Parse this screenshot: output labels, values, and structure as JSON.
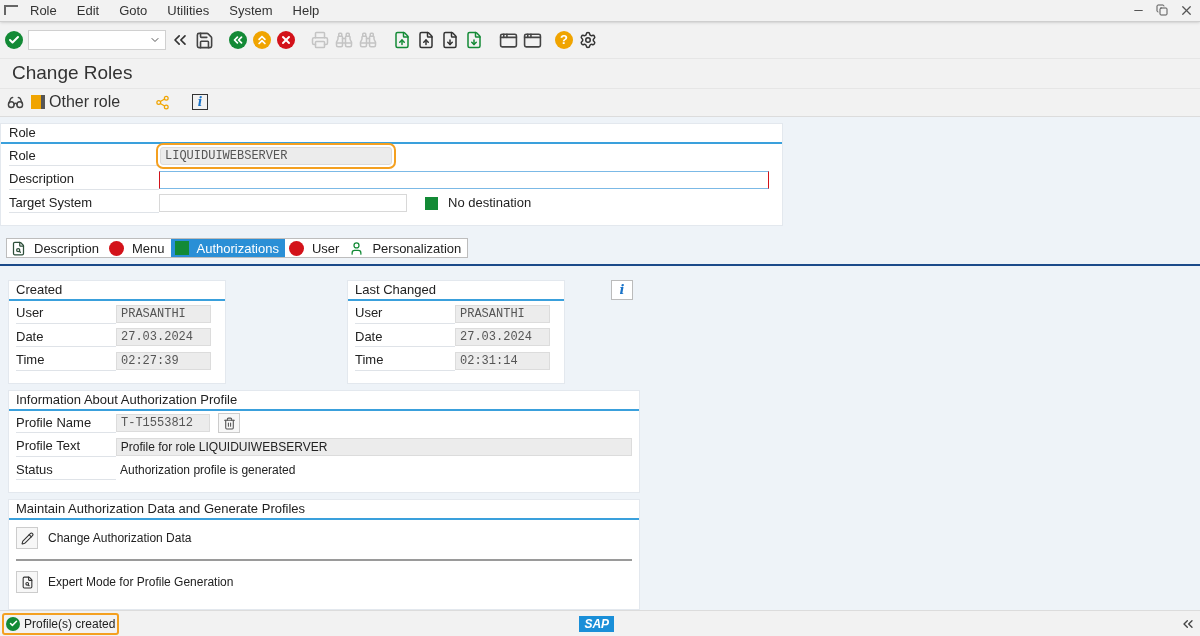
{
  "menu_bar": [
    "Role",
    "Edit",
    "Goto",
    "Utilities",
    "System",
    "Help"
  ],
  "toolbar": {
    "help": "?"
  },
  "title": "Change Roles",
  "app_toolbar": {
    "other_role": "Other role",
    "info": "i"
  },
  "role_panel": {
    "heading": "Role",
    "rows": [
      {
        "label": "Role",
        "value": "LIQUIDUIWEBSERVER",
        "kind": "readonly",
        "highlighted": true
      },
      {
        "label": "Description",
        "value": "",
        "kind": "focused",
        "highlighted": false
      },
      {
        "label": "Target System",
        "value": "",
        "kind": "input",
        "highlighted": false,
        "status": "No destination"
      }
    ]
  },
  "tabs": [
    {
      "label": "Description",
      "kind": "document",
      "selected": false
    },
    {
      "label": "Menu",
      "kind": "red-dot",
      "selected": false
    },
    {
      "label": "Authorizations",
      "kind": "green-square",
      "selected": true
    },
    {
      "label": "User",
      "kind": "red-dot",
      "selected": false
    },
    {
      "label": "Personalization",
      "kind": "person",
      "selected": false
    }
  ],
  "info_button": "i",
  "created": {
    "heading": "Created",
    "rows": [
      {
        "label": "User",
        "value": "PRASANTHI"
      },
      {
        "label": "Date",
        "value": "27.03.2024"
      },
      {
        "label": "Time",
        "value": "02:27:39"
      }
    ]
  },
  "last_changed": {
    "heading": "Last Changed",
    "rows": [
      {
        "label": "User",
        "value": "PRASANTHI"
      },
      {
        "label": "Date",
        "value": "27.03.2024"
      },
      {
        "label": "Time",
        "value": "02:31:14"
      }
    ]
  },
  "profile_info": {
    "heading": "Information About Authorization Profile",
    "profile_name_label": "Profile Name",
    "profile_name": "T-T1553812",
    "profile_text_label": "Profile Text",
    "profile_text": "Profile for role LIQUIDUIWEBSERVER",
    "status_label": "Status",
    "status": "Authorization profile is generated"
  },
  "maintain": {
    "heading": "Maintain Authorization Data and Generate Profiles",
    "actions": [
      {
        "label": "Change Authorization Data",
        "kind": "pencil"
      },
      {
        "label": "Expert Mode for Profile Generation",
        "kind": "document"
      }
    ]
  },
  "status_bar": {
    "message": "Profile(s) created",
    "highlighted": true,
    "logo": "SAP"
  }
}
